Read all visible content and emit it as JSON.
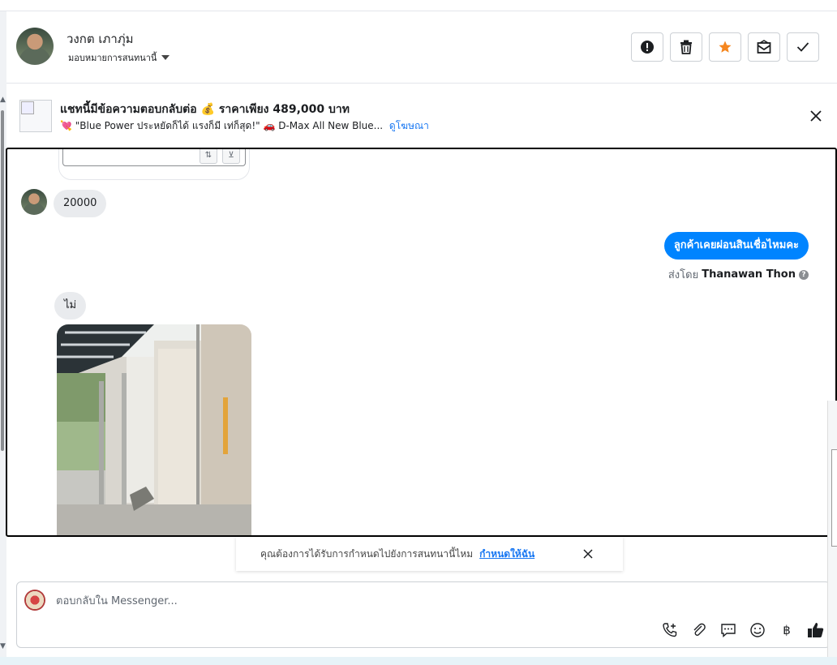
{
  "header": {
    "contact_name": "วงกต เภาภุ่ม",
    "assign_label": "มอบหมายการสนทนานี้",
    "actions": [
      {
        "name": "mark-spam",
        "icon": "alert-icon"
      },
      {
        "name": "delete",
        "icon": "trash-icon"
      },
      {
        "name": "star",
        "icon": "star-icon"
      },
      {
        "name": "mark-unread",
        "icon": "envelope-icon"
      },
      {
        "name": "mark-done",
        "icon": "check-icon"
      }
    ],
    "colors": {
      "star": "#f5861f"
    }
  },
  "ad_banner": {
    "title": "แชทนี้มีข้อความตอบกลับต่อ 💰 ราคาเพียง 489,000 บาท",
    "subtitle": "💘 \"Blue Power ประหยัดก็ได้ แรงก็มี เท่ก็สุด!\" 🚗 D-Max All New Blue...",
    "link_label": "ดูโฆษณา"
  },
  "messages": {
    "incoming_1": "20000",
    "outgoing_1": "ลูกค้าเคยผ่อนสินเชื่อไหมคะ",
    "sent_by_prefix": "ส่งโดย",
    "sent_by_agent": "Thanawan Thon",
    "incoming_2": "ไม่",
    "colors": {
      "outgoing_bubble": "#0084ff",
      "incoming_bubble": "#e9ebee"
    }
  },
  "suggestion": {
    "text": "คุณต้องการได้รับการกำหนดไปยังการสนทนานี้ไหม",
    "link": "กำหนดให้ฉัน"
  },
  "composer": {
    "placeholder": "ตอบกลับใน Messenger...",
    "tools": [
      "phone-plus-icon",
      "paperclip-icon",
      "saved-reply-icon",
      "emoji-icon",
      "baht-icon",
      "thumbs-up-icon"
    ]
  }
}
